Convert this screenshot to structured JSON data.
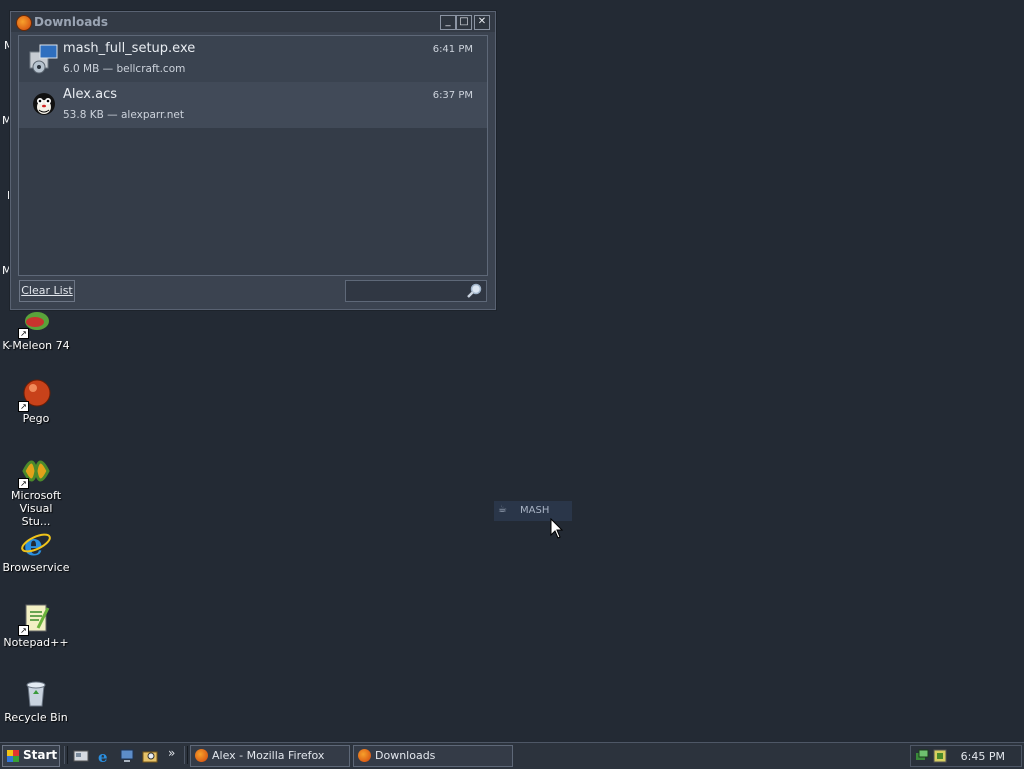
{
  "desktop": {
    "partial_labels": [
      "M",
      "M",
      "I",
      "M"
    ],
    "icons": [
      {
        "label": "K-Meleon 74"
      },
      {
        "label": "Pego"
      },
      {
        "label": "Microsoft Visual Stu..."
      },
      {
        "label": "Browservice"
      },
      {
        "label": "Notepad++"
      },
      {
        "label": "Recycle Bin"
      }
    ]
  },
  "downloads_window": {
    "title": "Downloads",
    "controls": {
      "minimize": "_",
      "maximize": "□",
      "close": "✕"
    },
    "items": [
      {
        "name": "mash_full_setup.exe",
        "info": "6.0 MB — bellcraft.com",
        "time": "6:41 PM"
      },
      {
        "name": "Alex.acs",
        "info": "53.8 KB — alexparr.net",
        "time": "6:37 PM"
      }
    ],
    "clear_list_label": "Clear List",
    "search_value": ""
  },
  "drag_ghost": {
    "label": "MASH"
  },
  "taskbar": {
    "start_label": "Start",
    "chevron": "»",
    "tasks": [
      {
        "label": "Alex - Mozilla Firefox"
      },
      {
        "label": "Downloads"
      }
    ],
    "clock": "6:45 PM"
  }
}
